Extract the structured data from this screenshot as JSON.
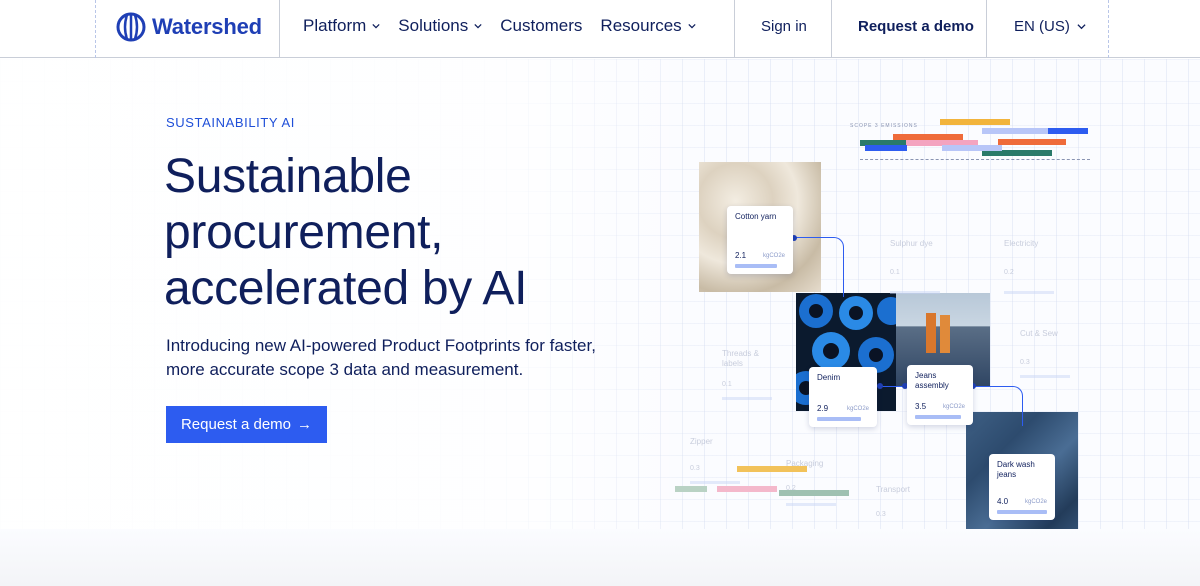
{
  "nav": {
    "brand": "Watershed",
    "menu": [
      {
        "label": "Platform",
        "chevron": true
      },
      {
        "label": "Solutions",
        "chevron": true
      },
      {
        "label": "Customers",
        "chevron": false
      },
      {
        "label": "Resources",
        "chevron": true
      }
    ],
    "sign_in": "Sign in",
    "request_demo": "Request a demo",
    "language": "EN (US)"
  },
  "hero": {
    "eyebrow": "SUSTAINABILITY AI",
    "headline": "Sustainable procurement, accelerated by AI",
    "subhead": "Introducing new AI-powered Product Footprints for faster, more accurate scope 3 data and measurement.",
    "cta": "Request a demo",
    "cta_arrow": "→"
  },
  "illustration": {
    "chart_caption": "SCOPE 3 EMISSIONS",
    "cards": [
      {
        "key": "cotton",
        "label": "Cotton yarn",
        "value": "2.1",
        "unit": "kgCO2e"
      },
      {
        "key": "denim",
        "label": "Denim",
        "value": "2.9",
        "unit": "kgCO2e"
      },
      {
        "key": "jeans_assembly",
        "label": "Jeans assembly",
        "value": "3.5",
        "unit": "kgCO2e"
      },
      {
        "key": "dark_wash",
        "label": "Dark wash jeans",
        "value": "4.0",
        "unit": "kgCO2e"
      }
    ],
    "ghost_cards": [
      {
        "key": "sulphur",
        "label": "Sulphur dye",
        "value": "0.1"
      },
      {
        "key": "electricity",
        "label": "Electricity",
        "value": "0.2"
      },
      {
        "key": "cut_sew",
        "label": "Cut & Sew",
        "value": "0.3"
      },
      {
        "key": "threads",
        "label": "Threads & labels",
        "value": "0.1"
      },
      {
        "key": "zipper",
        "label": "Zipper",
        "value": "0.3"
      },
      {
        "key": "packaging",
        "label": "Packaging",
        "value": "0.2"
      },
      {
        "key": "transport",
        "label": "Transport",
        "value": "0.3"
      }
    ]
  },
  "colors": {
    "brand_blue": "#1f3fb5",
    "cta_blue": "#2d5cf0",
    "ink": "#0f1f5c"
  }
}
